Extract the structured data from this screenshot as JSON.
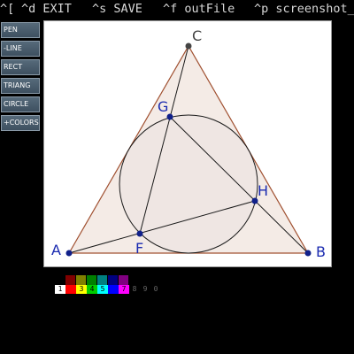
{
  "menubar": {
    "items": [
      "^[",
      "^d EXIT",
      "^s SAVE",
      "^f outFile",
      "^p screenshot_"
    ]
  },
  "toolbar": {
    "tools": [
      "PEN",
      "-LINE",
      "RECT",
      "TRIANG",
      "CIRCLE",
      "+COLORS"
    ]
  },
  "canvas": {
    "labels": {
      "A": "A",
      "B": "B",
      "C": "C",
      "F": "F",
      "G": "G",
      "H": "H"
    },
    "colors": {
      "triangle_stroke": "#a05030",
      "triangle_fill": "#f4ebe6",
      "circle_fill": "#efe6e3",
      "line": "#1a1a1a",
      "label": "#1a2ab0",
      "point": "#10208a",
      "vertex_c": "#444444"
    }
  },
  "palette": {
    "top_colors": [
      "#800000",
      "#808000",
      "#008000",
      "#008080",
      "#000080",
      "#800080"
    ],
    "numbers": [
      {
        "label": "1",
        "bg": "#ffffff",
        "fg": "#000000"
      },
      {
        "label": "2",
        "bg": "#ff0000",
        "fg": "#ff0000"
      },
      {
        "label": "3",
        "bg": "#ffff00",
        "fg": "#000000"
      },
      {
        "label": "4",
        "bg": "#00cc00",
        "fg": "#000000"
      },
      {
        "label": "5",
        "bg": "#00ffff",
        "fg": "#000000"
      },
      {
        "label": "6",
        "bg": "#0000ff",
        "fg": "#0000ff"
      },
      {
        "label": "7",
        "bg": "#ff00ff",
        "fg": "#000000"
      },
      {
        "label": "8",
        "bg": "#000000",
        "fg": "#666666"
      },
      {
        "label": "9",
        "bg": "#000000",
        "fg": "#666666"
      },
      {
        "label": "0",
        "bg": "#000000",
        "fg": "#666666"
      }
    ]
  }
}
